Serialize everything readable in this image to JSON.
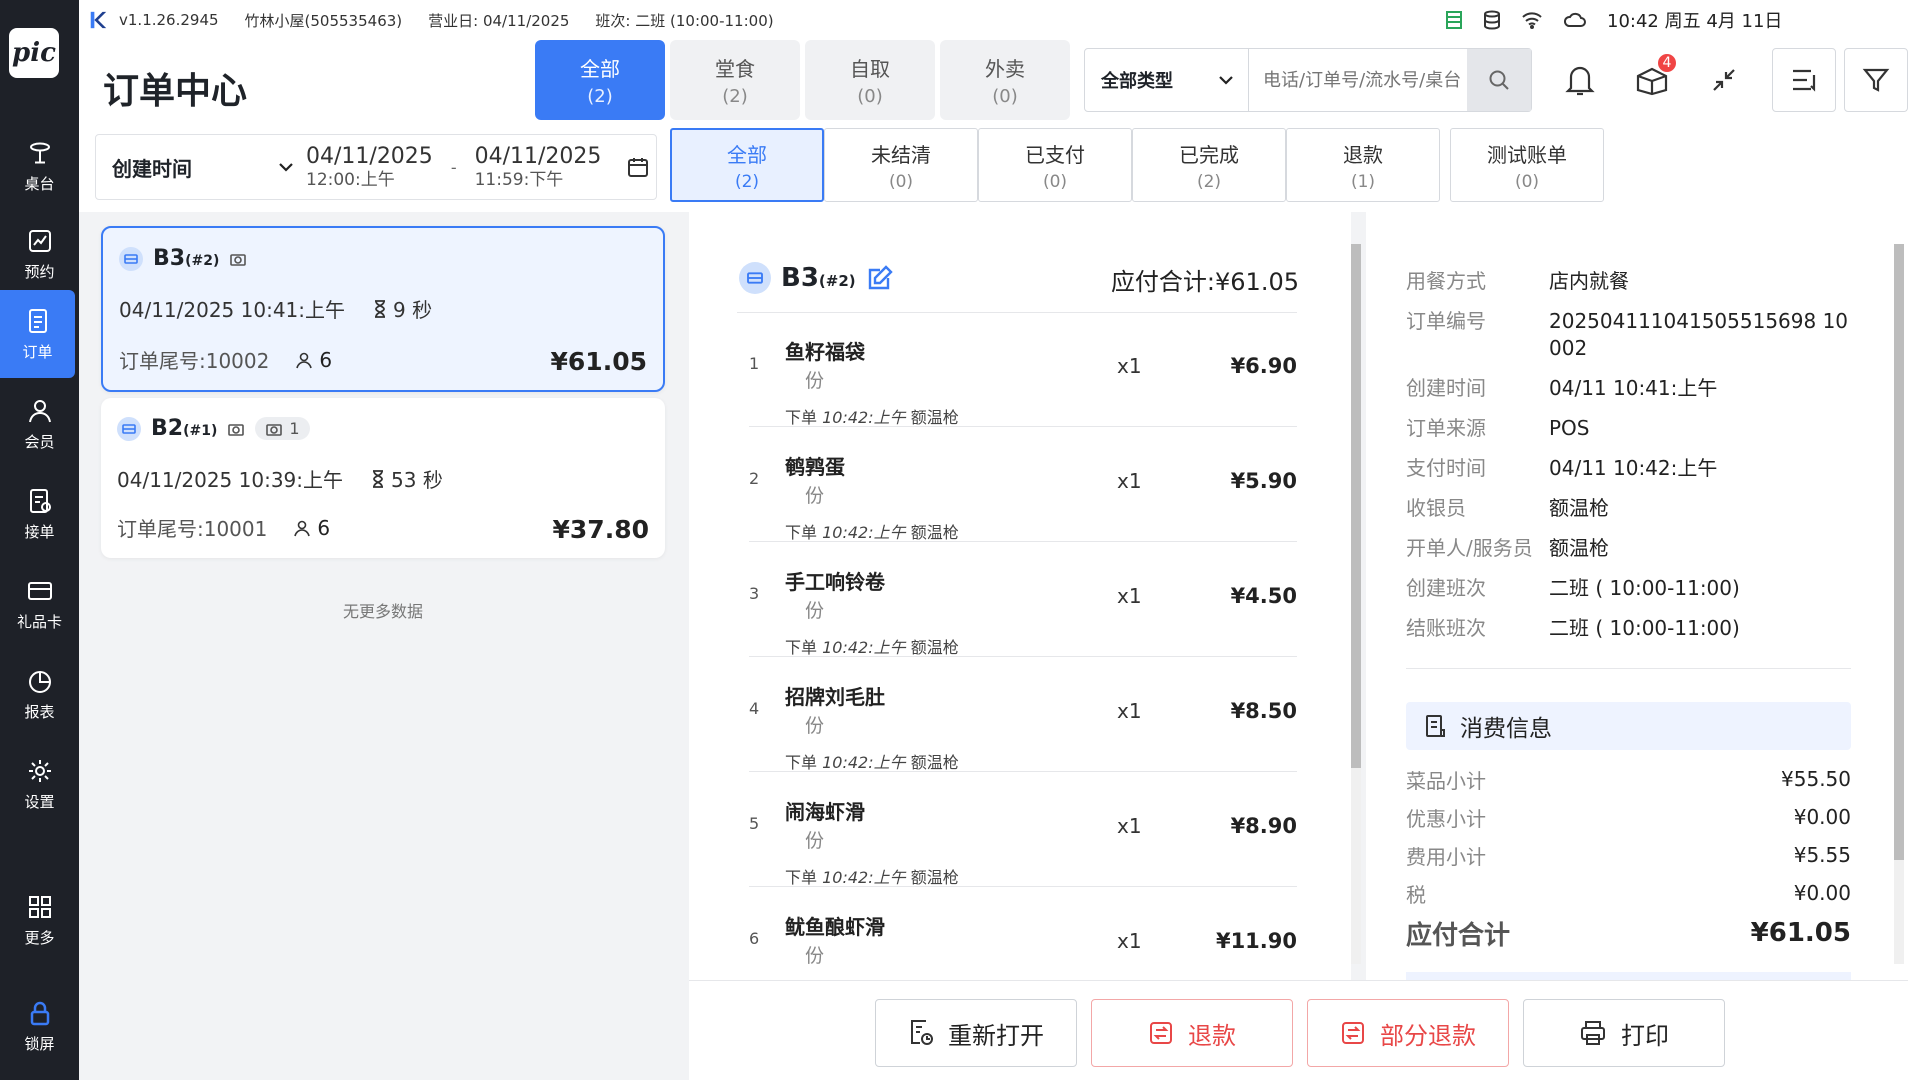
{
  "statusbar": {
    "version": "v1.1.26.2945",
    "store": "竹林小屋(505535463)",
    "business_day": "营业日: 04/11/2025",
    "shift": "班次:   二班 (10:00-11:00)",
    "clock": "10:42 周五 4月 11日"
  },
  "sidebar": {
    "brand": "pic",
    "items": [
      {
        "label": "桌台",
        "icon": "table-icon"
      },
      {
        "label": "预约",
        "icon": "reservation-icon"
      },
      {
        "label": "订单",
        "icon": "order-icon"
      },
      {
        "label": "会员",
        "icon": "member-icon"
      },
      {
        "label": "接单",
        "icon": "accept-order-icon"
      },
      {
        "label": "礼品卡",
        "icon": "gift-card-icon"
      },
      {
        "label": "报表",
        "icon": "report-icon"
      },
      {
        "label": "设置",
        "icon": "settings-icon"
      },
      {
        "label": "更多",
        "icon": "more-icon"
      },
      {
        "label": "锁屏",
        "icon": "lock-icon"
      }
    ]
  },
  "header": {
    "title": "订单中心",
    "channel_tabs": [
      {
        "label": "全部",
        "count": "(2)"
      },
      {
        "label": "堂食",
        "count": "(2)"
      },
      {
        "label": "自取",
        "count": "(0)"
      },
      {
        "label": "外卖",
        "count": "(0)"
      }
    ],
    "type_select": "全部类型",
    "search_placeholder": "电话/订单号/流水号/桌台",
    "notify_badge": "4",
    "date_filter": {
      "field": "创建时间",
      "start_date": "04/11/2025",
      "start_time": "12:00:上午",
      "separator": "-",
      "end_date": "04/11/2025",
      "end_time": "11:59:下午"
    },
    "status_tabs": [
      {
        "label": "全部",
        "count": "(2)"
      },
      {
        "label": "未结清",
        "count": "(0)"
      },
      {
        "label": "已支付",
        "count": "(0)"
      },
      {
        "label": "已完成",
        "count": "(2)"
      },
      {
        "label": "退款",
        "count": "(1)"
      },
      {
        "label": "测试账单",
        "count": "(0)"
      }
    ]
  },
  "orders": [
    {
      "table": "B3",
      "seq": "(#2)",
      "datetime": "04/11/2025 10:41:上午",
      "duration": "9 秒",
      "tail": "订单尾号:10002",
      "guests": "6",
      "amount": "¥61.05",
      "pill_count": ""
    },
    {
      "table": "B2",
      "seq": "(#1)",
      "datetime": "04/11/2025 10:39:上午",
      "duration": "53 秒",
      "tail": "订单尾号:10001",
      "guests": "6",
      "amount": "¥37.80",
      "pill_count": "1"
    }
  ],
  "no_more": "无更多数据",
  "detail": {
    "table": "B3",
    "seq": "(#2)",
    "total_label": "应付合计:¥61.05",
    "items": [
      {
        "no": "1",
        "name": "鱼籽福袋",
        "unit": "份",
        "qty": "x1",
        "price": "¥6.90",
        "meta_prefix": "下单",
        "meta_time": "10:42:上午",
        "meta_staff": "额温枪"
      },
      {
        "no": "2",
        "name": "鹌鹑蛋",
        "unit": "份",
        "qty": "x1",
        "price": "¥5.90",
        "meta_prefix": "下单",
        "meta_time": "10:42:上午",
        "meta_staff": "额温枪"
      },
      {
        "no": "3",
        "name": "手工响铃卷",
        "unit": "份",
        "qty": "x1",
        "price": "¥4.50",
        "meta_prefix": "下单",
        "meta_time": "10:42:上午",
        "meta_staff": "额温枪"
      },
      {
        "no": "4",
        "name": "招牌刘毛肚",
        "unit": "份",
        "qty": "x1",
        "price": "¥8.50",
        "meta_prefix": "下单",
        "meta_time": "10:42:上午",
        "meta_staff": "额温枪"
      },
      {
        "no": "5",
        "name": "闹海虾滑",
        "unit": "份",
        "qty": "x1",
        "price": "¥8.90",
        "meta_prefix": "下单",
        "meta_time": "10:42:上午",
        "meta_staff": "额温枪"
      },
      {
        "no": "6",
        "name": "鱿鱼酿虾滑",
        "unit": "份",
        "qty": "x1",
        "price": "¥11.90",
        "meta_prefix": "",
        "meta_time": "",
        "meta_staff": ""
      }
    ]
  },
  "info": [
    {
      "k": "用餐方式",
      "v": "店内就餐"
    },
    {
      "k": "订单编号",
      "v": "202504111041505515698 10002"
    },
    {
      "k": "创建时间",
      "v": "04/11 10:41:上午"
    },
    {
      "k": "订单来源",
      "v": "POS"
    },
    {
      "k": "支付时间",
      "v": "04/11 10:42:上午"
    },
    {
      "k": "收银员",
      "v": "额温枪"
    },
    {
      "k": "开单人/服务员",
      "v": "额温枪"
    },
    {
      "k": "创建班次",
      "v": "二班 ( 10:00-11:00)"
    },
    {
      "k": "结账班次",
      "v": "二班 ( 10:00-11:00)"
    }
  ],
  "consume": {
    "title": "消费信息",
    "rows": [
      {
        "k": "菜品小计",
        "v": "¥55.50"
      },
      {
        "k": "优惠小计",
        "v": "¥0.00"
      },
      {
        "k": "费用小计",
        "v": "¥5.55"
      },
      {
        "k": "税",
        "v": "¥0.00"
      }
    ],
    "total_k": "应付合计",
    "total_v": "¥61.05"
  },
  "actions": {
    "reopen": "重新打开",
    "refund": "退款",
    "partial_refund": "部分退款",
    "print": "打印"
  },
  "colors": {
    "accent": "#3a7bf5",
    "sidebar": "#1e2128",
    "danger": "#e84747"
  }
}
